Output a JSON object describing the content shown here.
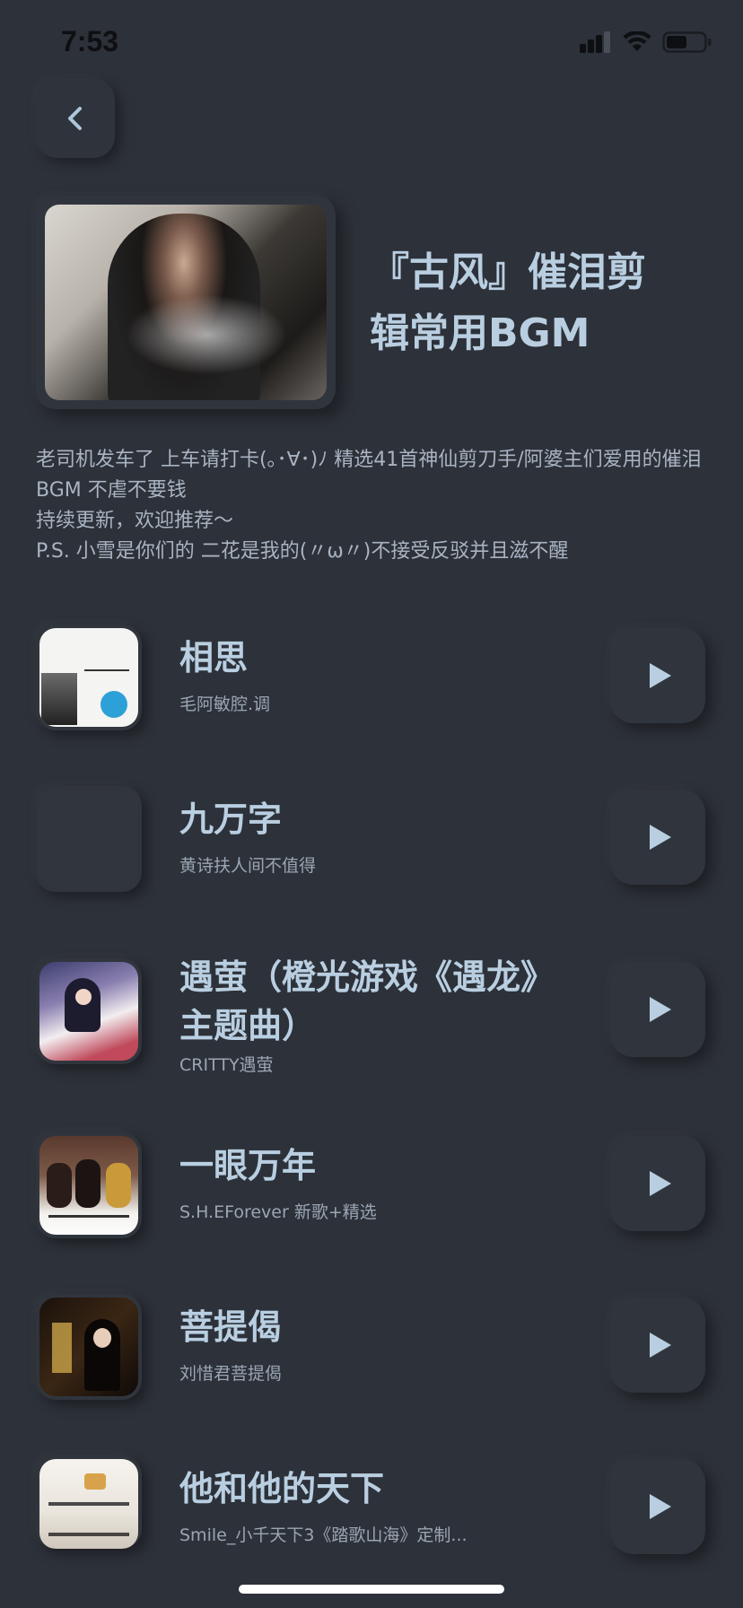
{
  "status_bar": {
    "time": "7:53"
  },
  "nav": {
    "back_icon": "chevron-left-icon"
  },
  "playlist": {
    "title": "『古风』催泪剪辑常用BGM",
    "description": "老司机发车了 上车请打卡(｡･∀･)ﾉ 精选41首神仙剪刀手/阿婆主们爱用的催泪BGM 不虐不要钱\n持续更新，欢迎推荐～\nP.S. 小雪是你们的 二花是我的(〃ω〃)不接受反驳并且滋不醒"
  },
  "songs": [
    {
      "title": "相思",
      "artist": "毛阿敏腔.调"
    },
    {
      "title": "九万字",
      "artist": "黄诗扶人间不值得"
    },
    {
      "title": "遇萤（橙光游戏《遇龙》主题曲）",
      "artist": "CRITTY遇萤"
    },
    {
      "title": "一眼万年",
      "artist": "S.H.EForever 新歌+精选"
    },
    {
      "title": "菩提偈",
      "artist": "刘惜君菩提偈"
    },
    {
      "title": "他和他的天下",
      "artist": "Smile_小千天下3《踏歌山海》定制..."
    }
  ],
  "colors": {
    "background": "#2d3139",
    "accent_text": "#b9cfe1",
    "secondary_text": "#9aa6b4"
  }
}
